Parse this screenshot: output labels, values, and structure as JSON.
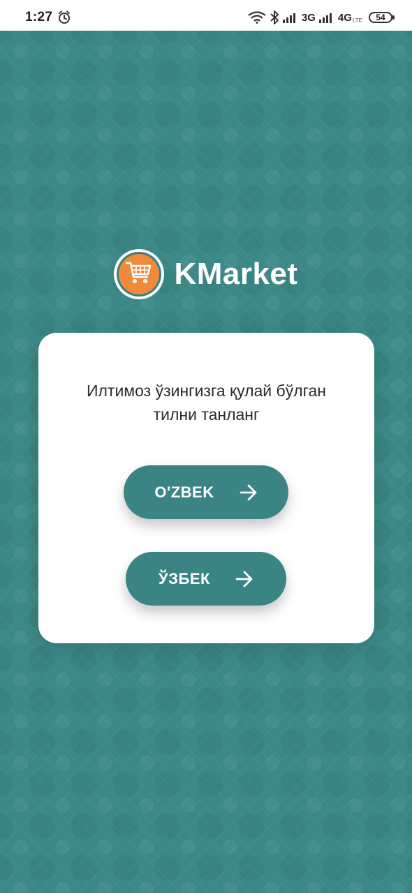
{
  "status_bar": {
    "time": "1:27",
    "network_1": "3G",
    "network_2": "4G",
    "network_2_sub": "LTE",
    "battery": "54",
    "icons": [
      "alarm-icon",
      "wifi-icon",
      "bluetooth-icon",
      "signal-icon",
      "signal-icon",
      "battery-icon"
    ]
  },
  "brand": {
    "name": "KMarket",
    "logo_icon": "shopping-cart-icon",
    "logo_color": "#f08a3a"
  },
  "language_card": {
    "prompt_line1": "Илтимоз ўзингизга қулай бўлган",
    "prompt_line2": "тилни танланг",
    "options": [
      {
        "label": "O'ZBEK",
        "icon": "arrow-right-icon"
      },
      {
        "label": "ЎЗБЕК",
        "icon": "arrow-right-icon"
      }
    ]
  },
  "colors": {
    "accent": "#3a8483",
    "background": "#3b8887",
    "card": "#ffffff",
    "logo_orange": "#f08a3a"
  }
}
